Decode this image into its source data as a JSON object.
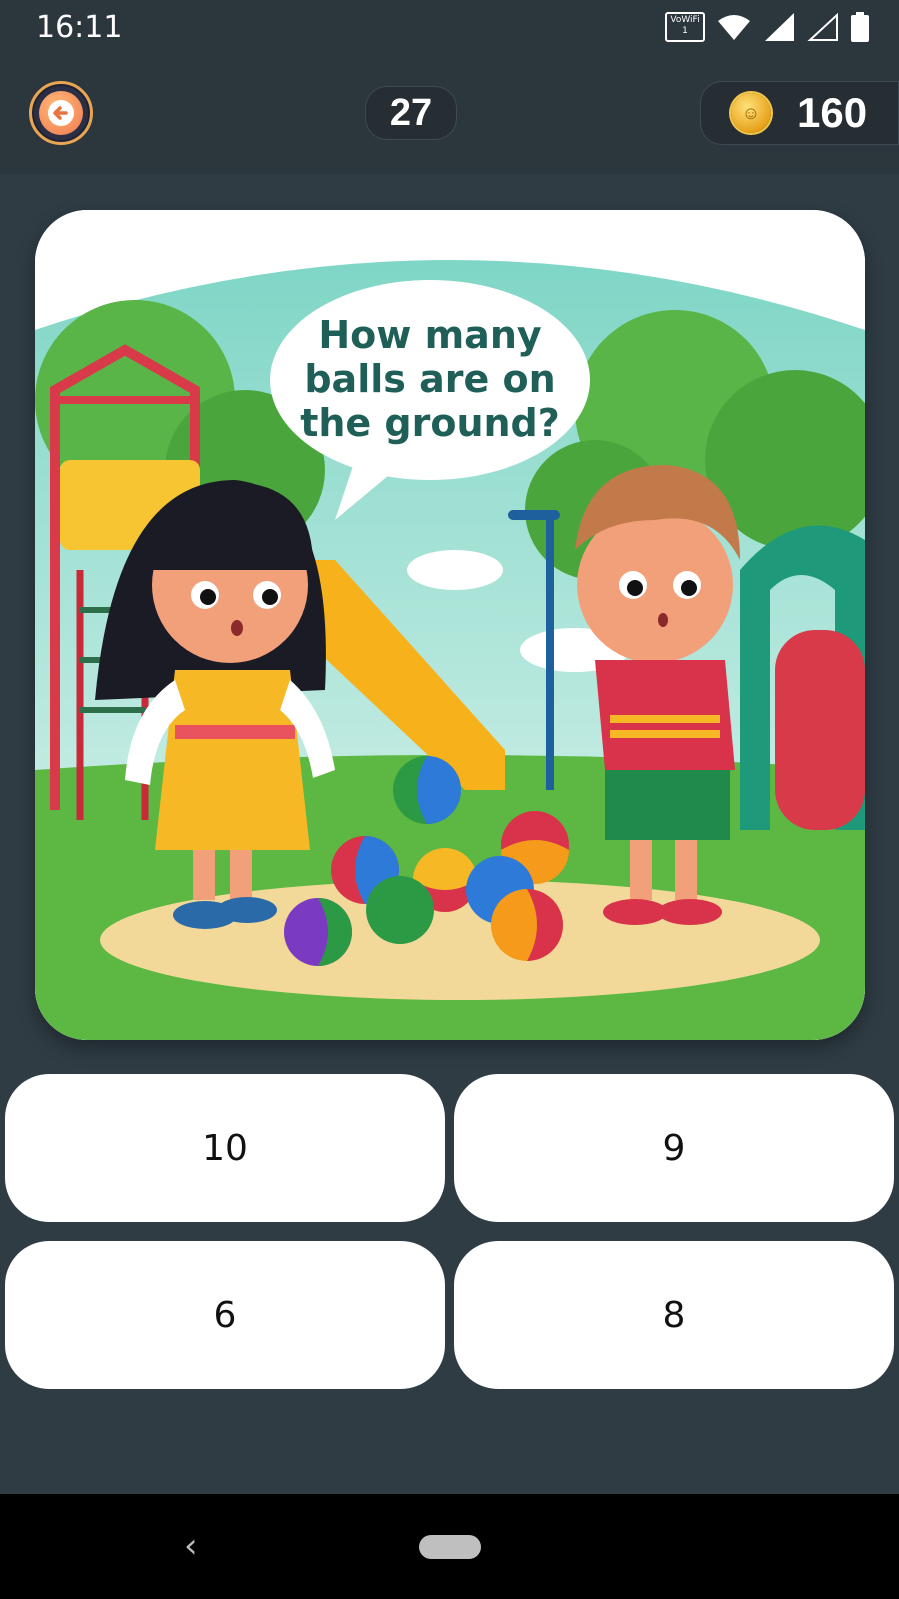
{
  "status_bar": {
    "time": "16:11",
    "vowifi_label": "VoWiFi",
    "vowifi_sim": "1",
    "icons": [
      "vowifi-icon",
      "wifi-icon",
      "signal-icon",
      "signal-empty-icon",
      "battery-icon"
    ]
  },
  "header": {
    "level": "27",
    "coins": "160",
    "back_icon": "back-arrow-icon",
    "coin_icon": "coin-icon"
  },
  "question": {
    "bubble_line1": "How many",
    "bubble_line2": "balls are on",
    "bubble_line3": "the ground?"
  },
  "answers": [
    "10",
    "9",
    "6",
    "8"
  ],
  "nav": {
    "back_glyph": "‹",
    "icons": [
      "nav-back-icon",
      "nav-home-pill"
    ]
  },
  "colors": {
    "background": "#2f3c44",
    "bar": "#2c363d",
    "answer_bg": "#ffffff",
    "bubble_text": "#1f5f58"
  }
}
